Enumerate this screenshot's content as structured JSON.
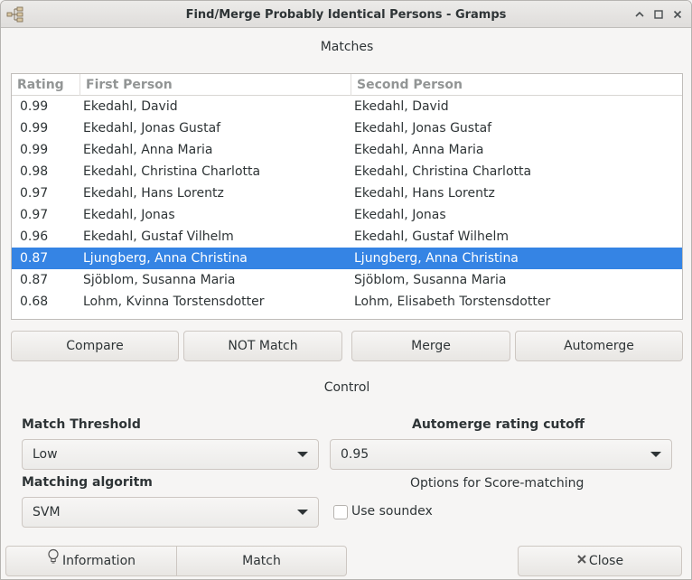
{
  "window": {
    "title": "Find/Merge Probably Identical Persons - Gramps",
    "controls": [
      "up-icon",
      "maximize-icon",
      "close-icon"
    ]
  },
  "matches_label": "Matches",
  "table": {
    "columns": [
      "Rating",
      "First Person",
      "Second Person"
    ],
    "rows": [
      {
        "rating": "0.99",
        "first": "Ekedahl, David",
        "second": "Ekedahl, David"
      },
      {
        "rating": "0.99",
        "first": "Ekedahl, Jonas Gustaf",
        "second": "Ekedahl, Jonas Gustaf"
      },
      {
        "rating": "0.99",
        "first": "Ekedahl, Anna Maria",
        "second": "Ekedahl, Anna Maria"
      },
      {
        "rating": "0.98",
        "first": "Ekedahl, Christina Charlotta",
        "second": "Ekedahl, Christina Charlotta"
      },
      {
        "rating": "0.97",
        "first": "Ekedahl, Hans Lorentz",
        "second": "Ekedahl, Hans Lorentz"
      },
      {
        "rating": "0.97",
        "first": "Ekedahl, Jonas",
        "second": "Ekedahl, Jonas"
      },
      {
        "rating": "0.96",
        "first": "Ekedahl, Gustaf Vilhelm",
        "second": "Ekedahl, Gustaf Wilhelm"
      },
      {
        "rating": "0.87",
        "first": "Ljungberg, Anna Christina",
        "second": "Ljungberg, Anna Christina",
        "selected": true
      },
      {
        "rating": "0.87",
        "first": "Sjöblom, Susanna Maria",
        "second": "Sjöblom, Susanna Maria"
      },
      {
        "rating": "0.68",
        "first": "Lohm, Kvinna Torstensdotter",
        "second": "Lohm, Elisabeth Torstensdotter"
      }
    ]
  },
  "actions": {
    "compare": "Compare",
    "not_match": "NOT Match",
    "merge": "Merge",
    "automerge": "Automerge"
  },
  "control_label": "Control",
  "match_threshold": {
    "label": "Match Threshold",
    "value": "Low"
  },
  "automerge_cutoff": {
    "label": "Automerge rating cutoff",
    "value": "0.95"
  },
  "matching_algorithm": {
    "label": "Matching algoritm",
    "value": "SVM"
  },
  "score_options_label": "Options for Score-matching",
  "use_soundex": {
    "label": "Use soundex",
    "checked": false
  },
  "footer": {
    "information": "Information",
    "match": "Match",
    "close": "Close"
  },
  "colors": {
    "selection": "#3584e4",
    "background": "#f6f5f4"
  }
}
